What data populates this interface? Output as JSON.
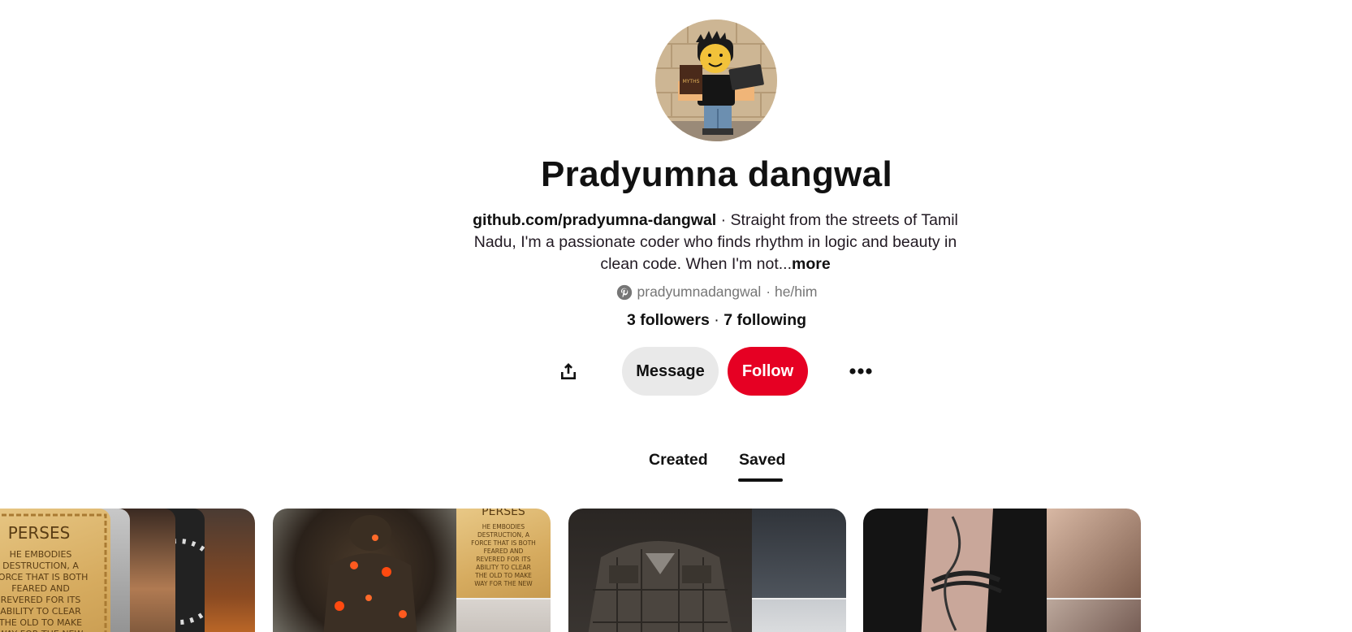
{
  "profile": {
    "name": "Pradyumna dangwal",
    "bio_link": "github.com/pradyumna-dangwal",
    "bio_text": " · Straight from the streets of Tamil Nadu, I'm a passionate coder who finds rhythm in logic and beauty in clean code. When I'm not...",
    "bio_more": "more",
    "handle": "pradyumnadangwal",
    "pronouns": " · he/him",
    "followers": "3 followers",
    "following": "7 following",
    "count_separator": " · "
  },
  "actions": {
    "message_label": "Message",
    "follow_label": "Follow"
  },
  "tabs": [
    {
      "label": "Created",
      "active": false
    },
    {
      "label": "Saved",
      "active": true
    }
  ],
  "boards": {
    "parchment_title": "PERSES",
    "parchment_text": "HE EMBODIES DESTRUCTION, A FORCE THAT IS BOTH FEARED AND REVERED FOR ITS ABILITY TO CLEAR THE OLD TO MAKE WAY FOR THE NEW"
  },
  "colors": {
    "follow_accent": "#e60023",
    "message_bg": "#e9e9e9",
    "text": "#111111",
    "muted": "#767676"
  },
  "icons": [
    "share-icon",
    "more-options-icon",
    "pinterest-icon"
  ]
}
